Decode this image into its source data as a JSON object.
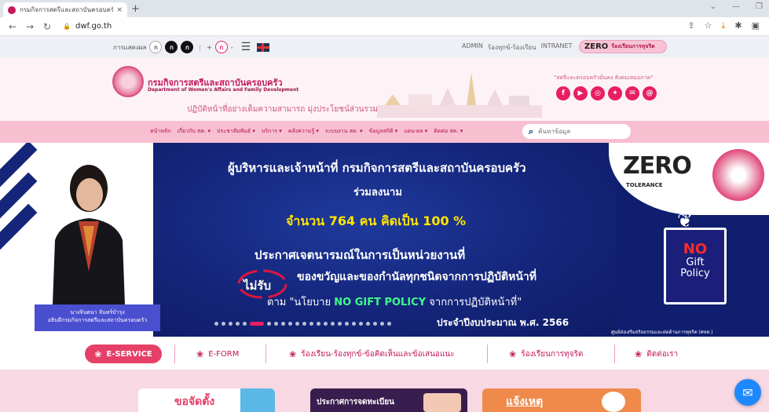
{
  "browser": {
    "tab_title": "กรมกิจการสตรีและสถาบันครอบครัว",
    "tab_close": "×",
    "new_tab": "+",
    "url": "dwf.go.th"
  },
  "topbar": {
    "display_label": "การแสดงผล",
    "contrast_options": [
      "ก",
      "ก",
      "ก"
    ],
    "font_size_options": [
      "+",
      "ก",
      "-"
    ],
    "links": [
      "ADMIN",
      "ร้องทุกข์-ร้องเรียน",
      "INTRANET"
    ],
    "zero_label": "ZERO",
    "zero_text": "ร้องเรียนการทุจริต"
  },
  "header": {
    "org_name_th": "กรมกิจการสตรีและสถาบันครอบครัว",
    "org_name_en": "Department of Women's Affairs and Family Development",
    "tagline": "ปฏิบัติหน้าที่อย่างเต็มความสามารถ มุ่งประโยชน์ส่วนรวม",
    "slogan": "\"สตรีและครอบครัวมั่นคง สังคมเสมอภาค\""
  },
  "nav": {
    "items": [
      "หน้าหลัก",
      "เกี่ยวกับ สค. ▾",
      "ประชาสัมพันธ์ ▾",
      "บริการ ▾",
      "คลังความรู้ ▾",
      "ระบบงาน สค. ▾",
      "ข้อมูลสถิติ ▾",
      "แผน-ผล ▾",
      "ติดต่อ สค. ▾"
    ],
    "search_placeholder": "ค้นหาข้อมูล"
  },
  "banner": {
    "person_name": "นางจินตนา จันทร์บำรุง",
    "person_title": "อธิบดีกรมกิจการสตรีและสถาบันครอบครัว",
    "line1": "ผู้บริหารและเจ้าหน้าที่ กรมกิจการสตรีและสถาบันครอบครัว",
    "line2": "ร่วมลงนาม",
    "line3": "จำนวน 764 คน คิดเป็น 100 %",
    "line4": "ประกาศเจตนารมณ์ในการเป็นหน่วยงานที่",
    "no_receive": "ไม่รับ",
    "line5": "ของขวัญและของกำนัลทุกชนิดจากการปฏิบัติหน้าที่",
    "line6_pre": "ตาม \"นโยบาย",
    "line6_hi": "NO GIFT POLICY",
    "line6_post": "จากการปฏิบัติหน้าที่\"",
    "line7": "ประจำปีงบประมาณ พ.ศ. 2566",
    "zero_logo": "ZERO",
    "zero_tolerance": "TOLERANCE",
    "gift_no": "NO",
    "gift_text": "Gift",
    "gift_policy": "Policy",
    "footer_text": "ศูนย์ส่งเสริมจริยธรรมและต่อต้านการทุจริต (ศจท.)",
    "slide_count": 24,
    "active_slide": 5
  },
  "services": {
    "items": [
      "E-SERVICE",
      "E-FORM",
      "ร้องเรียน-ร้องทุกข์-ข้อคิดเห็นและข้อเสนอแนะ",
      "ร้องเรียนการทุจริต",
      "ติดต่อเรา"
    ],
    "active": "E-SERVICE"
  },
  "cards": {
    "card1": "ขอจัดตั้ง",
    "card2": "ประกาศการจดทะเบียน",
    "card3": "แจ้งเหตุ"
  },
  "colors": {
    "brand_pink": "#c2185b",
    "nav_pink": "#f7bfd0",
    "banner_navy": "#0f1e6e",
    "highlight_yellow": "#ffe500",
    "highlight_green": "#3dff8a"
  }
}
